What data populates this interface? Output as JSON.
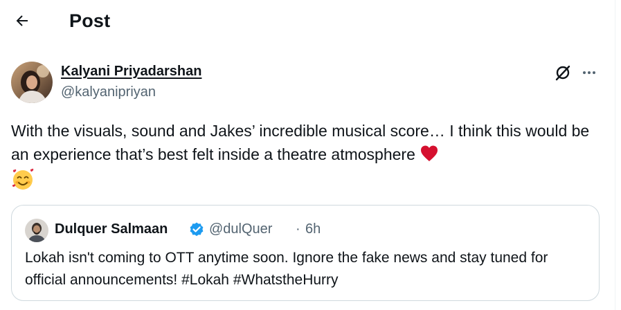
{
  "header": {
    "title": "Post",
    "back_icon": "arrow-left-icon"
  },
  "post": {
    "author_name": "Kalyani Priyadarshan",
    "author_handle": "@kalyanipriyan",
    "text": "With the visuals, sound and Jakes’ incredible musical score… I think this would be an experience that’s best felt inside a theatre atmosphere",
    "emojis": [
      "red-heart",
      "smiling-face-with-hearts"
    ],
    "actions": [
      "grok-icon",
      "more-options-icon"
    ]
  },
  "quote": {
    "author_name": "Dulquer Salmaan",
    "verified": true,
    "author_handle": "@dulQuer",
    "separator": "·",
    "time": "6h",
    "text": "Lokah isn't coming to OTT anytime soon. Ignore the fake news and stay tuned for official announcements! #Lokah #WhatstheHurry"
  },
  "colors": {
    "text_primary": "#0f1419",
    "text_secondary": "#536471",
    "border": "#cfd9de",
    "verified_blue": "#1d9bf0",
    "heart_red": "#d5102f"
  }
}
